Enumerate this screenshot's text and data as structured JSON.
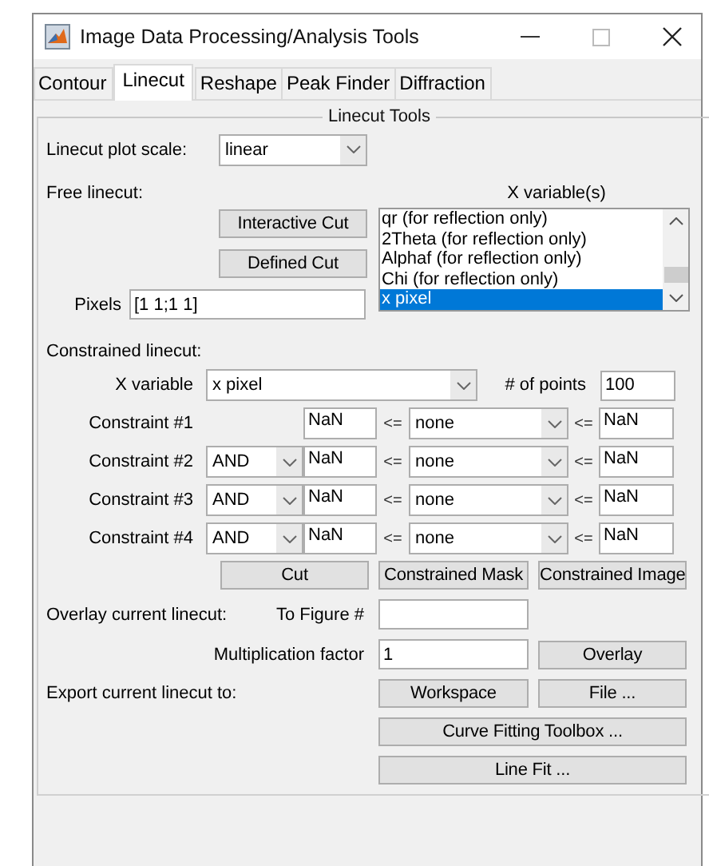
{
  "window": {
    "title": "Image Data Processing/Analysis Tools"
  },
  "tabs": [
    {
      "label": "Contour",
      "selected": false
    },
    {
      "label": "Linecut",
      "selected": true
    },
    {
      "label": "Reshape",
      "selected": false
    },
    {
      "label": "Peak Finder",
      "selected": false
    },
    {
      "label": "Diffraction",
      "selected": false
    }
  ],
  "panel": {
    "title": "Linecut Tools",
    "plot_scale": {
      "label": "Linecut plot scale:",
      "value": "linear"
    },
    "free_linecut": {
      "label": "Free linecut:",
      "x_variables_label": "X variable(s)",
      "buttons": [
        "Interactive Cut",
        "Defined Cut"
      ],
      "x_variables": [
        {
          "label": "qr (for reflection only)",
          "selected": false
        },
        {
          "label": "2Theta (for reflection only)",
          "selected": false
        },
        {
          "label": "Alphaf (for reflection only)",
          "selected": false
        },
        {
          "label": "Chi (for reflection only)",
          "selected": false
        },
        {
          "label": "x pixel",
          "selected": true
        }
      ],
      "pixels": {
        "label": "Pixels",
        "value": "[1 1;1 1]"
      }
    },
    "constrained": {
      "label": "Constrained linecut:",
      "x_variable": {
        "label": "X variable",
        "value": "x pixel"
      },
      "points": {
        "label": "# of points",
        "value": "100"
      },
      "constraints": [
        {
          "label": "Constraint #1",
          "lower": "NaN",
          "lower_op": "<=",
          "variable": "none",
          "upper_op": "<=",
          "upper": "NaN"
        },
        {
          "label": "Constraint #2",
          "operator": "AND",
          "lower": "NaN",
          "lower_op": "<=",
          "variable": "none",
          "upper_op": "<=",
          "upper": "NaN"
        },
        {
          "label": "Constraint #3",
          "operator": "AND",
          "lower": "NaN",
          "lower_op": "<=",
          "variable": "none",
          "upper_op": "<=",
          "upper": "NaN"
        },
        {
          "label": "Constraint #4",
          "operator": "AND",
          "lower": "NaN",
          "lower_op": "<=",
          "variable": "none",
          "upper_op": "<=",
          "upper": "NaN"
        }
      ],
      "buttons": [
        "Cut",
        "Constrained Mask",
        "Constrained Image"
      ]
    },
    "overlay": {
      "label": "Overlay current linecut:",
      "figure": {
        "label": "To Figure #"
      },
      "factor": {
        "label": "Multiplication factor",
        "value": "1"
      },
      "button": "Overlay"
    },
    "export": {
      "label": "Export current linecut to:",
      "buttons": [
        "Workspace",
        "File ...",
        "Curve Fitting Toolbox ...",
        "Line Fit ..."
      ]
    }
  }
}
